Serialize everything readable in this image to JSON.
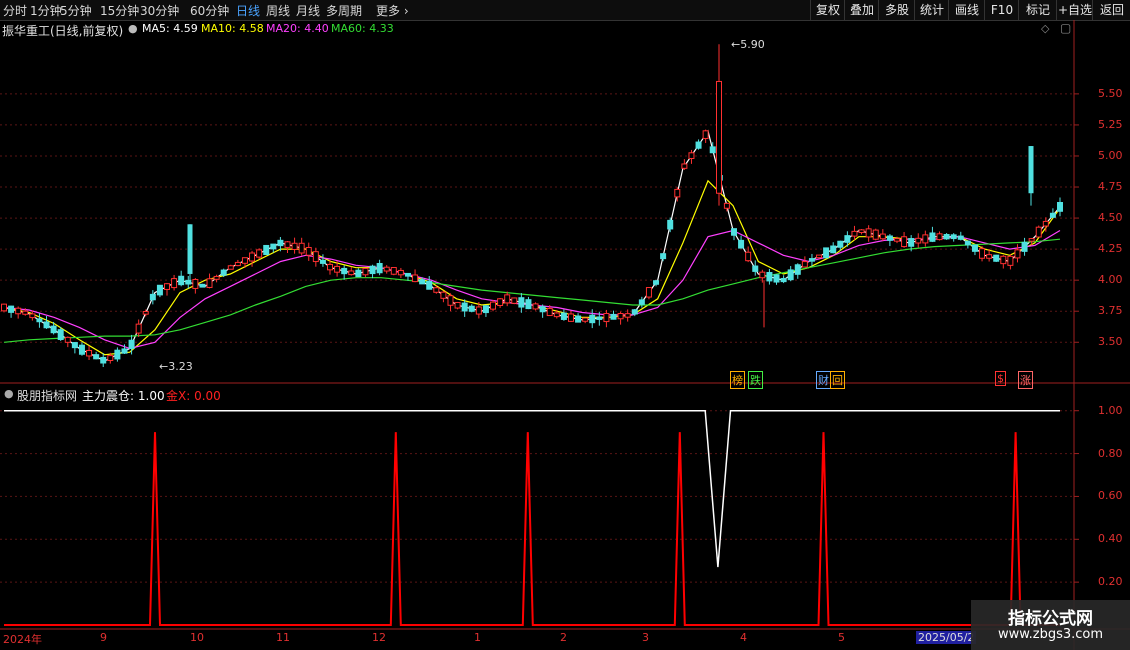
{
  "toolbar": {
    "periods": [
      {
        "label": "分时",
        "active": false
      },
      {
        "label": "1分钟",
        "active": false
      },
      {
        "label": "5分钟",
        "active": false
      },
      {
        "label": "15分钟",
        "active": false
      },
      {
        "label": "30分钟",
        "active": false
      },
      {
        "label": "60分钟",
        "active": false
      },
      {
        "label": "日线",
        "active": true
      },
      {
        "label": "周线",
        "active": false
      },
      {
        "label": "月线",
        "active": false
      },
      {
        "label": "多周期",
        "active": false
      },
      {
        "label": "更多",
        "active": false
      }
    ],
    "buttons": [
      "复权",
      "叠加",
      "多股",
      "统计",
      "画线",
      "F10",
      "标记",
      "+自选",
      "返回"
    ]
  },
  "main_panel": {
    "stock_title": "振华重工(日线,前复权)",
    "ma": [
      {
        "label": "MA5:",
        "value": "4.59",
        "color": "#ffffff"
      },
      {
        "label": "MA10:",
        "value": "4.58",
        "color": "#ffff00"
      },
      {
        "label": "MA20:",
        "value": "4.40",
        "color": "#ff40ff"
      },
      {
        "label": "MA60:",
        "value": "4.33",
        "color": "#33dd33"
      }
    ],
    "high_label": "5.90",
    "low_label": "3.23",
    "events": [
      {
        "text": "榜",
        "color": "#ffb000"
      },
      {
        "text": "跌",
        "color": "#44ee44"
      },
      {
        "text": "财",
        "color": "#66aaff"
      },
      {
        "text": "回",
        "color": "#ffb000"
      },
      {
        "text": "$",
        "color": "#ff3333"
      },
      {
        "text": "涨",
        "color": "#ff6666"
      }
    ]
  },
  "indicator_panel": {
    "name": "股朋指标网",
    "line1_label": "主力震仓:",
    "line1_value": "1.00",
    "line2_label": "金X:",
    "line2_value": "0.00"
  },
  "dates": [
    "2024年",
    "9",
    "10",
    "11",
    "12",
    "1",
    "2",
    "3",
    "4",
    "5",
    "2025/05/2"
  ],
  "watermark": {
    "line1": "指标公式网",
    "line2": "www.zbgs3.com"
  },
  "chart_data": [
    {
      "type": "line",
      "title": "振华重工(日线,前复权)",
      "y_ticks": [
        5.5,
        5.25,
        5.0,
        4.75,
        4.5,
        4.25,
        4.0,
        3.75,
        3.5
      ],
      "ylim": [
        3.18,
        5.95
      ],
      "x_ticks": [
        "2024年",
        "9",
        "10",
        "11",
        "12",
        "1",
        "2",
        "3",
        "4",
        "5",
        "2025/05/2"
      ],
      "series": [
        {
          "name": "MA5",
          "color": "#ffffff",
          "last": 4.59,
          "values": [
            3.78,
            3.73,
            3.6,
            3.45,
            3.35,
            3.45,
            3.9,
            4.0,
            3.95,
            4.1,
            4.2,
            4.3,
            4.25,
            4.1,
            4.05,
            4.1,
            4.05,
            3.95,
            3.8,
            3.75,
            3.85,
            3.8,
            3.72,
            3.68,
            3.7,
            3.72,
            4.0,
            4.9,
            5.2,
            4.4,
            4.05,
            4.0,
            4.15,
            4.25,
            4.4,
            4.35,
            4.3,
            4.35,
            4.35,
            4.2,
            4.15,
            4.35,
            4.59
          ]
        },
        {
          "name": "MA10",
          "color": "#ffff00",
          "last": 4.58,
          "values": [
            3.78,
            3.74,
            3.65,
            3.52,
            3.4,
            3.42,
            3.6,
            3.9,
            4.0,
            4.05,
            4.15,
            4.25,
            4.25,
            4.15,
            4.1,
            4.1,
            4.05,
            3.98,
            3.85,
            3.8,
            3.82,
            3.8,
            3.75,
            3.7,
            3.7,
            3.72,
            3.85,
            4.3,
            4.8,
            4.6,
            4.15,
            4.05,
            4.1,
            4.2,
            4.35,
            4.35,
            4.33,
            4.33,
            4.35,
            4.25,
            4.2,
            4.3,
            4.58
          ]
        },
        {
          "name": "MA20",
          "color": "#ff40ff",
          "last": 4.4,
          "values": [
            3.78,
            3.76,
            3.7,
            3.62,
            3.52,
            3.45,
            3.5,
            3.7,
            3.85,
            3.95,
            4.05,
            4.15,
            4.2,
            4.17,
            4.12,
            4.1,
            4.05,
            4.0,
            3.92,
            3.85,
            3.82,
            3.8,
            3.78,
            3.74,
            3.72,
            3.72,
            3.78,
            4.0,
            4.35,
            4.4,
            4.3,
            4.2,
            4.15,
            4.2,
            4.28,
            4.32,
            4.33,
            4.33,
            4.35,
            4.3,
            4.25,
            4.28,
            4.4
          ]
        },
        {
          "name": "MA60",
          "color": "#33dd33",
          "last": 4.33,
          "values": [
            3.5,
            3.52,
            3.53,
            3.54,
            3.55,
            3.55,
            3.56,
            3.6,
            3.66,
            3.72,
            3.8,
            3.87,
            3.95,
            4.0,
            4.02,
            4.02,
            4.0,
            3.98,
            3.95,
            3.92,
            3.9,
            3.88,
            3.86,
            3.84,
            3.82,
            3.8,
            3.8,
            3.85,
            3.92,
            3.97,
            4.02,
            4.06,
            4.1,
            4.14,
            4.18,
            4.22,
            4.25,
            4.27,
            4.28,
            4.29,
            4.3,
            4.31,
            4.33
          ]
        }
      ]
    },
    {
      "type": "line",
      "title": "股朋指标网",
      "y_ticks": [
        1.0,
        0.8,
        0.6,
        0.4,
        0.2
      ],
      "ylim": [
        0,
        1.05
      ],
      "series": [
        {
          "name": "主力震仓",
          "color": "#ffffff",
          "last": 1.0,
          "note_points": [
            [
              0,
              1.0
            ],
            [
              0.664,
              1.0
            ],
            [
              0.676,
              0.27
            ],
            [
              0.688,
              1.0
            ],
            [
              1.0,
              1.0
            ]
          ]
        },
        {
          "name": "金X",
          "color": "#ff0000",
          "last": 0.0,
          "spikes_at": [
            0.143,
            0.371,
            0.496,
            0.64,
            0.776,
            0.958
          ],
          "spike_value": 0.9
        }
      ]
    }
  ]
}
